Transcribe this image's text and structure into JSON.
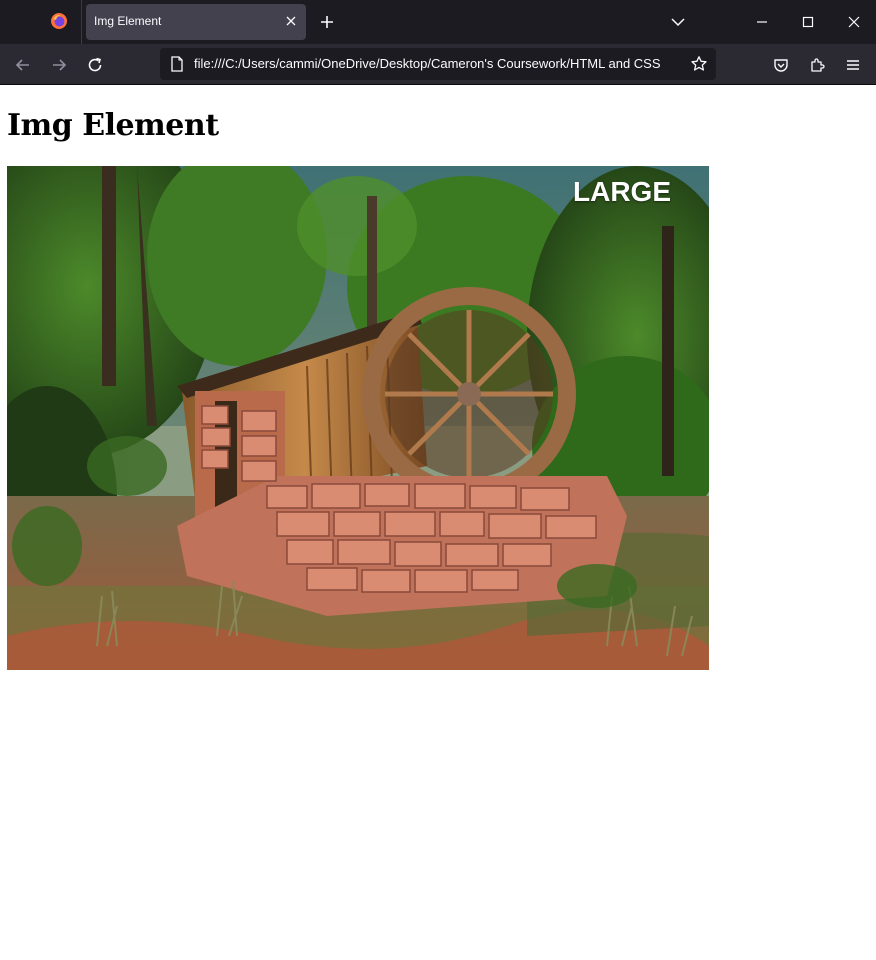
{
  "browser": {
    "tab_title": "Img Element",
    "url": "file:///C:/Users/cammi/OneDrive/Desktop/Cameron's Coursework/HTML and CSS"
  },
  "page": {
    "heading": "Img Element",
    "image": {
      "overlay_label": "LARGE",
      "description_icon": "stone-mill-waterwheel-photo"
    }
  },
  "colors": {
    "tabbar_bg": "#1c1b22",
    "navbar_bg": "#2b2a33",
    "active_tab_bg": "#42414d"
  }
}
